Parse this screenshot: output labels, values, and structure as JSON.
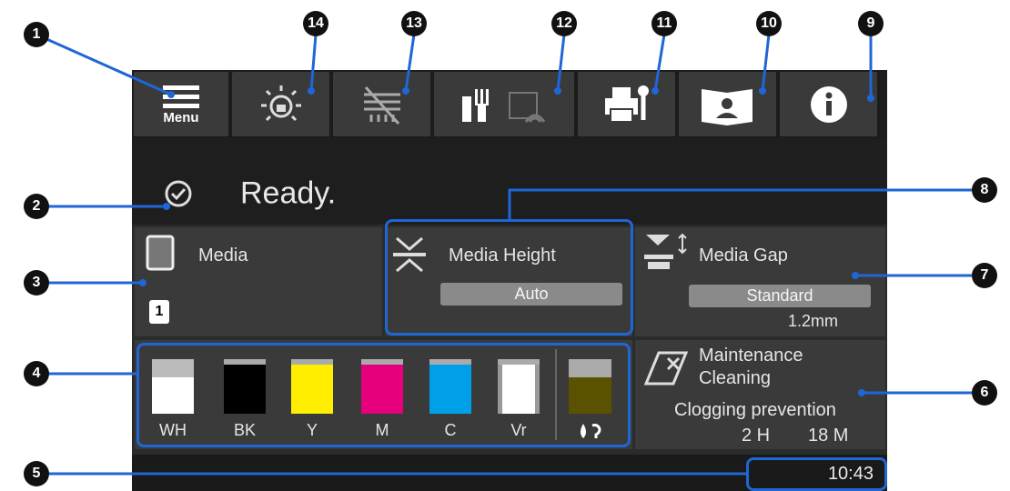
{
  "callouts": [
    "1",
    "2",
    "3",
    "4",
    "5",
    "6",
    "7",
    "8",
    "9",
    "10",
    "11",
    "12",
    "13",
    "14"
  ],
  "toolbar": {
    "menu_label": "Menu"
  },
  "status": {
    "text": "Ready."
  },
  "media": {
    "title": "Media",
    "number": "1"
  },
  "media_height": {
    "title": "Media Height",
    "value": "Auto"
  },
  "media_gap": {
    "title": "Media Gap",
    "value": "Standard",
    "measure": "1.2mm"
  },
  "inks": [
    {
      "label": "WH",
      "color": "#ffffff"
    },
    {
      "label": "BK",
      "color": "#000000"
    },
    {
      "label": "Y",
      "color": "#ffee00"
    },
    {
      "label": "M",
      "color": "#e6007e"
    },
    {
      "label": "C",
      "color": "#00a0e9"
    },
    {
      "label": "Vr",
      "color": "#ffffff"
    }
  ],
  "maintenance": {
    "title1": "Maintenance",
    "title2": "Cleaning",
    "subtitle": "Clogging prevention",
    "hours": "2 H",
    "minutes": "18 M"
  },
  "clock": "10:43",
  "colors": {
    "highlight": "#1f66d6",
    "screen": "#2b2b2b",
    "panel": "#3a3a3a"
  }
}
